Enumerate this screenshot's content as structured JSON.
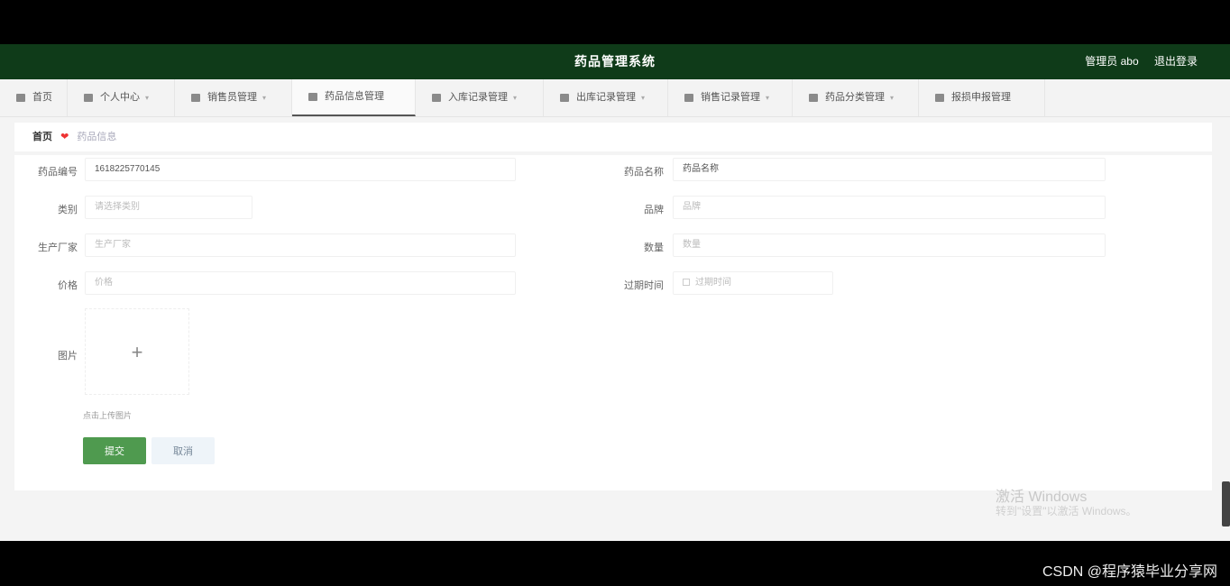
{
  "header": {
    "title": "药品管理系统",
    "user": "管理员 abo",
    "logout": "退出登录"
  },
  "nav": {
    "items": [
      {
        "label": "首页",
        "has_menu": false
      },
      {
        "label": "个人中心",
        "has_menu": true
      },
      {
        "label": "销售员管理",
        "has_menu": true
      },
      {
        "label": "药品信息管理",
        "has_menu": false
      },
      {
        "label": "入库记录管理",
        "has_menu": true
      },
      {
        "label": "出库记录管理",
        "has_menu": true
      },
      {
        "label": "销售记录管理",
        "has_menu": true
      },
      {
        "label": "药品分类管理",
        "has_menu": true
      },
      {
        "label": "报损申报管理",
        "has_menu": false
      }
    ],
    "active_index": 3
  },
  "breadcrumb": {
    "home": "首页",
    "current": "药品信息"
  },
  "form": {
    "code_label": "药品编号",
    "code_value": "1618225770145",
    "name_label": "药品名称",
    "name_value": "药品名称",
    "category_label": "类别",
    "category_placeholder": "请选择类别",
    "brand_label": "品牌",
    "brand_placeholder": "品牌",
    "maker_label": "生产厂家",
    "maker_placeholder": "生产厂家",
    "qty_label": "数量",
    "qty_placeholder": "数量",
    "price_label": "价格",
    "price_placeholder": "价格",
    "expiry_label": "过期时间",
    "expiry_placeholder": "过期时间",
    "image_label": "图片",
    "upload_hint": "点击上传图片",
    "submit_label": "提交",
    "cancel_label": "取消"
  },
  "watermark": {
    "line1": "激活 Windows",
    "line2": "转到\"设置\"以激活 Windows。"
  },
  "credit": "CSDN @程序猿毕业分享网"
}
